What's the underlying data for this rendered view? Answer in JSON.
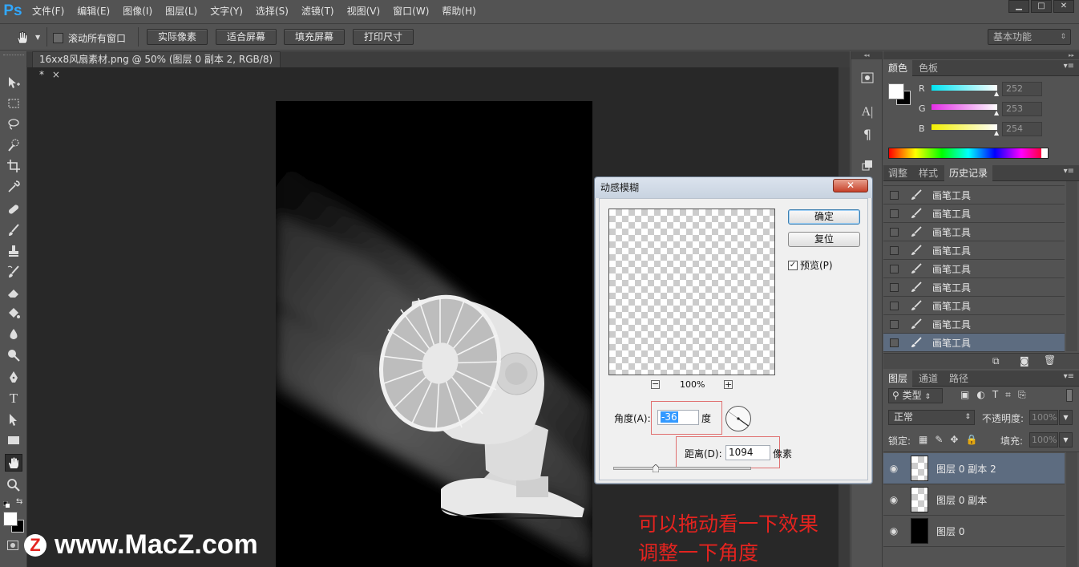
{
  "app": {
    "logo": "Ps"
  },
  "menu": [
    "文件(F)",
    "编辑(E)",
    "图像(I)",
    "图层(L)",
    "文字(Y)",
    "选择(S)",
    "滤镜(T)",
    "视图(V)",
    "窗口(W)",
    "帮助(H)"
  ],
  "window_controls": [
    "▁",
    "□",
    "✕"
  ],
  "options": {
    "scroll_all_label": "滚动所有窗口",
    "buttons": [
      "实际像素",
      "适合屏幕",
      "填充屏幕",
      "打印尺寸"
    ],
    "workspace": "基本功能"
  },
  "document": {
    "tab_title": "16xx8风扇素材.png @ 50% (图层 0 副本 2, RGB/8) *",
    "close": "×"
  },
  "color_panel": {
    "tabs": [
      "颜色",
      "色板"
    ],
    "channels": [
      {
        "label": "R",
        "value": "252",
        "color": "#35e8f0"
      },
      {
        "label": "G",
        "value": "253",
        "color": "#e440e6"
      },
      {
        "label": "B",
        "value": "254",
        "color": "#f1f03a"
      }
    ]
  },
  "history_panel": {
    "tabs": [
      "调整",
      "样式",
      "历史记录"
    ],
    "items": [
      "画笔工具",
      "画笔工具",
      "画笔工具",
      "画笔工具",
      "画笔工具",
      "画笔工具",
      "画笔工具",
      "画笔工具",
      "画笔工具"
    ]
  },
  "layers_panel": {
    "tabs": [
      "图层",
      "通道",
      "路径"
    ],
    "filter": "类型",
    "blend_mode": "正常",
    "opacity_label": "不透明度:",
    "opacity_value": "100%",
    "lock_label": "锁定:",
    "fill_label": "填充:",
    "fill_value": "100%",
    "layers": [
      {
        "name": "图层 0 副本 2",
        "selected": true
      },
      {
        "name": "图层 0 副本",
        "selected": false
      },
      {
        "name": "图层 0",
        "selected": false
      }
    ]
  },
  "dialog": {
    "title": "动感模糊",
    "ok": "确定",
    "reset": "复位",
    "preview_label": "预览(P)",
    "zoom_minus": "−",
    "zoom_plus": "+",
    "zoom": "100%",
    "angle_label": "角度(A):",
    "angle_value": "-36",
    "angle_unit": "度",
    "distance_label": "距离(D):",
    "distance_value": "1094",
    "distance_unit": "像素",
    "distance_slider": 0.31
  },
  "annotations": [
    "可以拖动看一下效果",
    "调整一下角度"
  ],
  "watermark": {
    "logo": "Z",
    "text": "www.MacZ.com"
  }
}
